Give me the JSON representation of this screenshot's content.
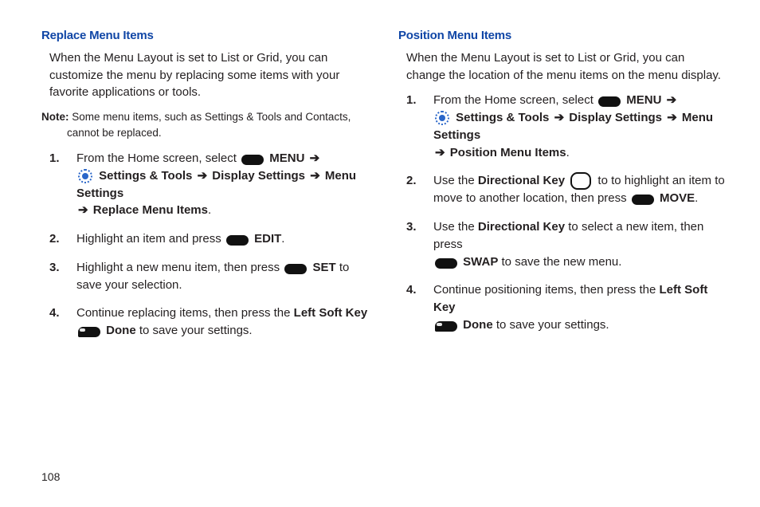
{
  "page_number": "108",
  "left": {
    "heading": "Replace Menu Items",
    "intro": "When the Menu Layout is set to List or Grid, you can customize the menu by replacing some items with your favorite applications or tools.",
    "note_label": "Note:",
    "note_text": " Some menu items, such as Settings & Tools and Contacts, cannot be replaced.",
    "step1_a": "From the Home screen, select ",
    "step1_menu": " MENU ",
    "step1_b": " Settings & Tools ",
    "step1_c": " Display Settings ",
    "step1_d": " Menu Settings ",
    "step1_e": " Replace Menu Items",
    "step2_a": "Highlight an item and press ",
    "step2_edit": " EDIT",
    "step3_a": "Highlight a new menu item, then press ",
    "step3_set": " SET",
    "step3_b": " to save your selection.",
    "step4_a": "Continue replacing items, then press the ",
    "step4_lsk": "Left Soft Key",
    "step4_done": " Done",
    "step4_b": " to save your settings."
  },
  "right": {
    "heading": "Position Menu Items",
    "intro": "When the Menu Layout is set to List or Grid, you can change the location of the menu items on the menu display.",
    "step1_a": "From the Home screen, select ",
    "step1_menu": " MENU ",
    "step1_b": " Settings & Tools ",
    "step1_c": " Display Settings ",
    "step1_d": " Menu Settings ",
    "step1_e": " Position Menu Items",
    "step2_a": "Use the ",
    "step2_dk": "Directional Key",
    "step2_b": " to to highlight an item to move to another location, then press ",
    "step2_move": " MOVE",
    "step3_a": "Use the ",
    "step3_dk": "Directional Key",
    "step3_b": " to select a new item, then press ",
    "step3_swap": " SWAP",
    "step3_c": " to save the new menu.",
    "step4_a": "Continue positioning items, then press the ",
    "step4_lsk": "Left Soft Key",
    "step4_done": " Done",
    "step4_b": " to save your settings."
  },
  "arrow": "➔",
  "period": "."
}
